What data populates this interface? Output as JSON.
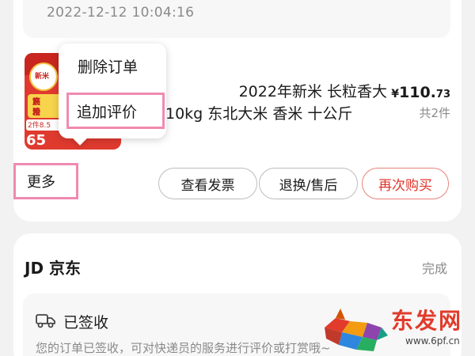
{
  "order": {
    "timestamp": "2022-12-12 10:04:16",
    "product": {
      "title_line1": "2022年新米 长粒香大",
      "title_line2": "10kg 东北大米 香米  十公斤",
      "price_symbol": "¥",
      "price_int": "110.",
      "price_dec": "73",
      "qty": "共2件"
    },
    "buttons": {
      "more": "更多",
      "invoice": "查看发票",
      "return": "退换/售后",
      "rebuy": "再次购买"
    },
    "popup_menu": {
      "delete": "删除订单",
      "review": "追加评价"
    },
    "thumbnail_text": {
      "badge": "新米",
      "line1": "筋粮",
      "line2": "爽滑",
      "promo": "2件8.5",
      "big": "65"
    }
  },
  "order2": {
    "store": "JD 京东",
    "status": "完成",
    "delivery_status": "已签收",
    "delivery_desc": "您的订单已签收，可对快递员的服务进行评价或打赏哦~"
  },
  "watermark": {
    "name": "东发网",
    "url": "www.6pf.cn"
  },
  "colors": {
    "accent": "#e0322b",
    "highlight_box": "#f08ab0",
    "muted": "#8a8a8a"
  }
}
